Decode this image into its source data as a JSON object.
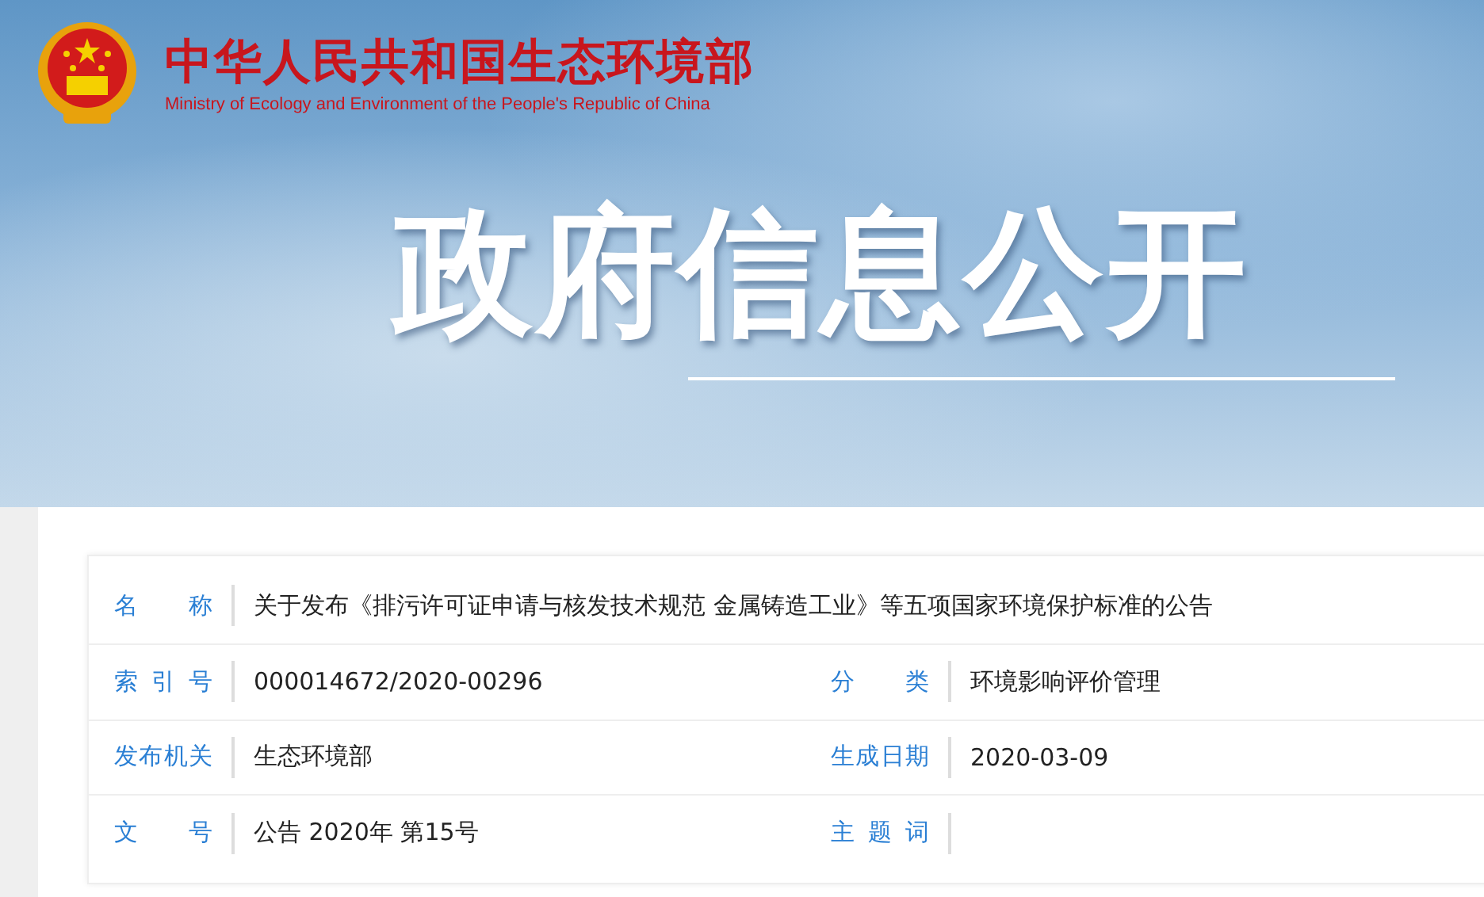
{
  "header": {
    "title": "中华人民共和国生态环境部",
    "subtitle": "Ministry of Ecology and Environment of the People's Republic of China"
  },
  "banner": {
    "title": "政府信息公开"
  },
  "info_rows": [
    {
      "cells": [
        {
          "label": "名称",
          "value": "关于发布《排污许可证申请与核发技术规范 金属铸造工业》等五项国家环境保护标准的公告"
        }
      ]
    },
    {
      "cells": [
        {
          "label": "索引号",
          "value": "000014672/2020-00296"
        },
        {
          "label": "分类",
          "value": "环境影响评价管理"
        }
      ]
    },
    {
      "cells": [
        {
          "label": "发布机关",
          "value": "生态环境部"
        },
        {
          "label": "生成日期",
          "value": "2020-03-09"
        }
      ]
    },
    {
      "cells": [
        {
          "label": "文号",
          "value": "公告 2020年 第15号"
        },
        {
          "label": "主题词"
        }
      ]
    }
  ]
}
